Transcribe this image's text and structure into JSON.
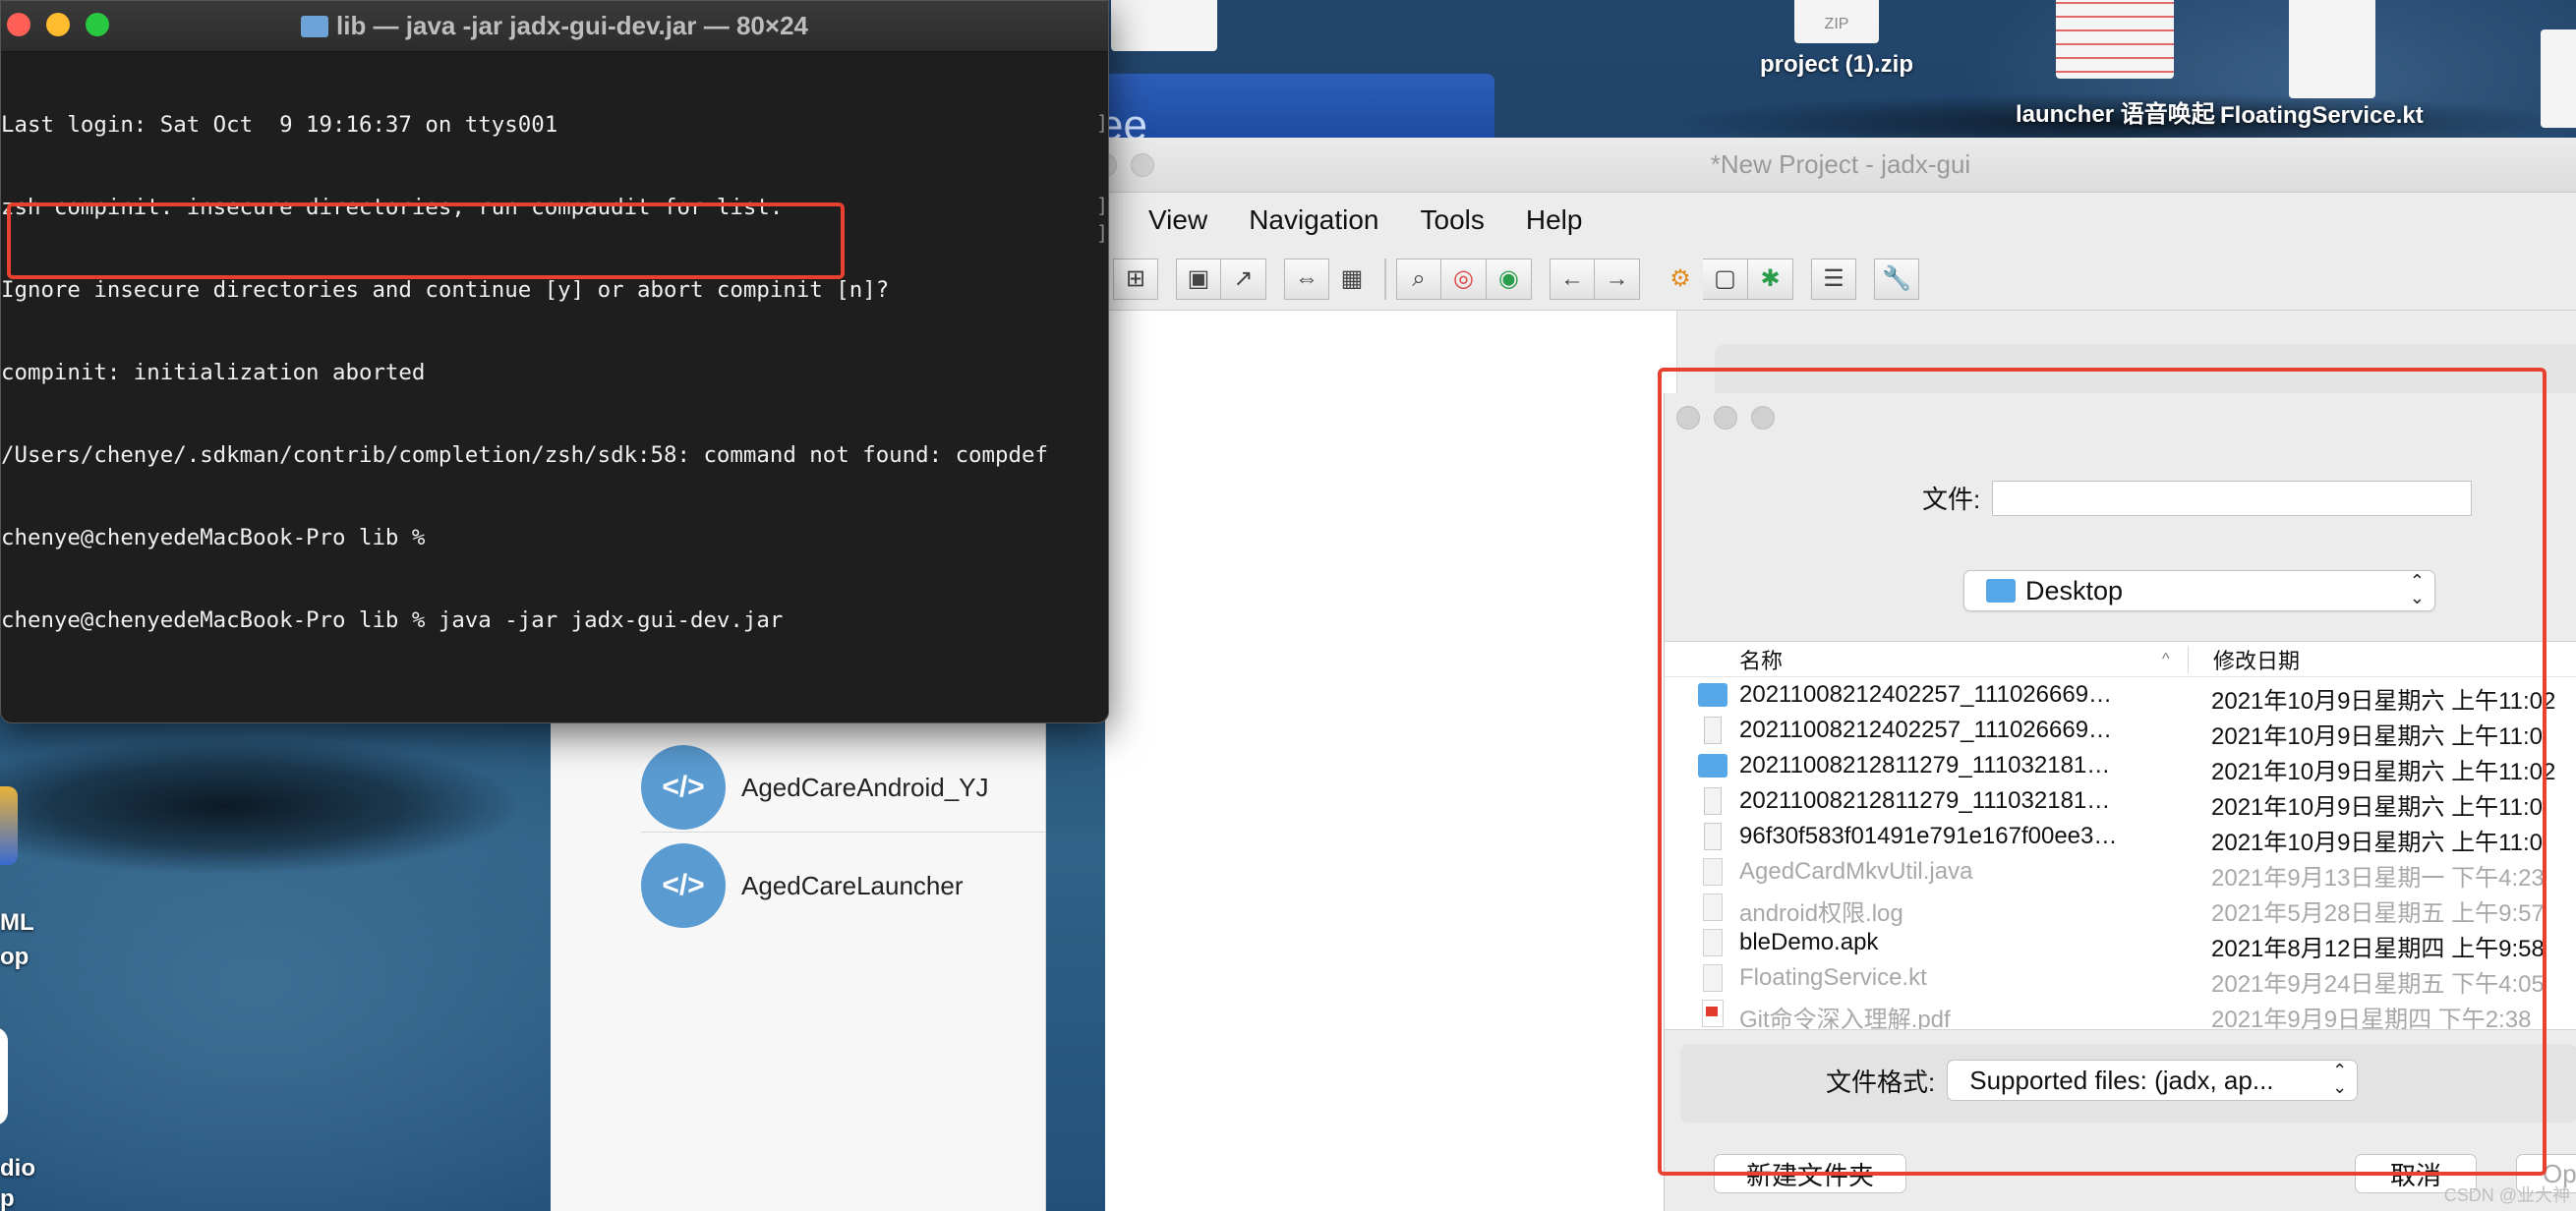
{
  "terminal": {
    "title": "lib — java -jar jadx-gui-dev.jar — 80×24",
    "lines": {
      "l1": "Last login: Sat Oct  9 19:16:37 on ttys001",
      "l2": "zsh compinit: insecure directories, run compaudit for list.",
      "l3": "Ignore insecure directories and continue [y] or abort compinit [n]?",
      "l4": "compinit: initialization aborted",
      "l5": "/Users/chenye/.sdkman/contrib/completion/zsh/sdk:58: command not found: compdef",
      "l6": "chenye@chenyedeMacBook-Pro lib %",
      "l7": "chenye@chenyedeMacBook-Pro lib % java -jar jadx-gui-dev.jar"
    }
  },
  "desktop": {
    "icons": {
      "zip": {
        "label": "project (1).zip",
        "badge": "ZIP"
      },
      "launcher": {
        "label": "launcher 语音唤起"
      },
      "floating": {
        "label": "FloatingService.kt"
      }
    },
    "blue_window_text": "ee",
    "side_labels": {
      "a": "ML",
      "b": "op",
      "c": "dio",
      "d": "p"
    }
  },
  "projects": [
    {
      "icon": "</>",
      "name": "AgedCareAndroid_YJ"
    },
    {
      "icon": "</>",
      "name": "AgedCareLauncher"
    }
  ],
  "jadx": {
    "title": "*New Project - jadx-gui",
    "menu": [
      "View",
      "Navigation",
      "Tools",
      "Help"
    ]
  },
  "dialog": {
    "file_label": "文件:",
    "file_value": "",
    "location": "Desktop",
    "col_name": "名称",
    "col_date": "修改日期",
    "sort_indicator": "^",
    "files": [
      {
        "icon": "folder-icon",
        "name": "20211008212402257_111026669…",
        "date": "2021年10月9日星期六 上午11:02",
        "style": "dark"
      },
      {
        "icon": "zip-file-icon",
        "name": "20211008212402257_111026669…",
        "date": "2021年10月9日星期六 上午11:0",
        "style": "dark"
      },
      {
        "icon": "folder-icon",
        "name": "20211008212811279_111032181…",
        "date": "2021年10月9日星期六 上午11:02",
        "style": "dark"
      },
      {
        "icon": "zip-file-icon",
        "name": "20211008212811279_111032181…",
        "date": "2021年10月9日星期六 上午11:0",
        "style": "dark"
      },
      {
        "icon": "zip-file-icon",
        "name": "96f30f583f01491e791e167f00ee3…",
        "date": "2021年10月9日星期六 上午11:0",
        "style": "dark"
      },
      {
        "icon": "document-icon",
        "name": "AgedCardMkvUtil.java",
        "date": "2021年9月13日星期一 下午4:23",
        "style": "dim"
      },
      {
        "icon": "document-icon",
        "name": "android权限.log",
        "date": "2021年5月28日星期五 上午9:57",
        "style": "dim"
      },
      {
        "icon": "document-icon",
        "name": "bleDemo.apk",
        "date": "2021年8月12日星期四 上午9:58",
        "style": "dark"
      },
      {
        "icon": "document-icon",
        "name": "FloatingService.kt",
        "date": "2021年9月24日星期五 下午4:05",
        "style": "dim"
      },
      {
        "icon": "pdf-icon",
        "name": "Git命令深入理解.pdf",
        "date": "2021年9月9日星期四 下午2:38",
        "style": "dim"
      }
    ],
    "format_label": "文件格式:",
    "format_value": "Supported files: (jadx, ap...",
    "new_folder": "新建文件夹",
    "cancel": "取消",
    "open": "Op"
  },
  "watermark": "CSDN @业大神",
  "colors": {
    "highlight": "#e8412f",
    "project_icon": "#5a9bd2",
    "folder": "#55a7e8"
  }
}
